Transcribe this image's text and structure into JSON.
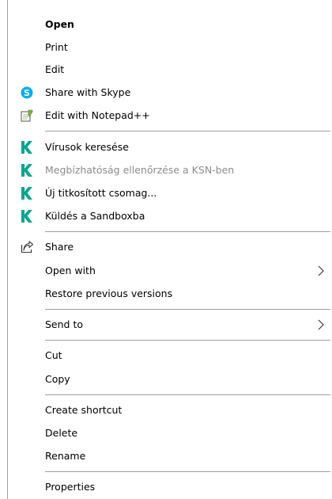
{
  "menu": {
    "items": [
      {
        "label": "Open"
      },
      {
        "label": "Print"
      },
      {
        "label": "Edit"
      },
      {
        "label": "Share with Skype"
      },
      {
        "label": "Edit with Notepad++"
      },
      {
        "label": "Vírusok keresése"
      },
      {
        "label": "Megbízhatóság ellenőrzése a KSN-ben"
      },
      {
        "label": "Új titkosított csomag..."
      },
      {
        "label": "Küldés a Sandboxba"
      },
      {
        "label": "Share"
      },
      {
        "label": "Open with"
      },
      {
        "label": "Restore previous versions"
      },
      {
        "label": "Send to"
      },
      {
        "label": "Cut"
      },
      {
        "label": "Copy"
      },
      {
        "label": "Create shortcut"
      },
      {
        "label": "Delete"
      },
      {
        "label": "Rename"
      },
      {
        "label": "Properties"
      }
    ]
  },
  "icons": {
    "skype": "skype-icon",
    "notepad": "notepad-plus-plus-icon",
    "kaspersky": "kaspersky-k-icon",
    "share": "share-icon",
    "submenu": "chevron-right-icon"
  },
  "colors": {
    "skype_blue": "#00aff0",
    "kaspersky_green": "#00a88e",
    "disabled_text": "#8c8c8c",
    "separator": "#a0a0a0"
  }
}
